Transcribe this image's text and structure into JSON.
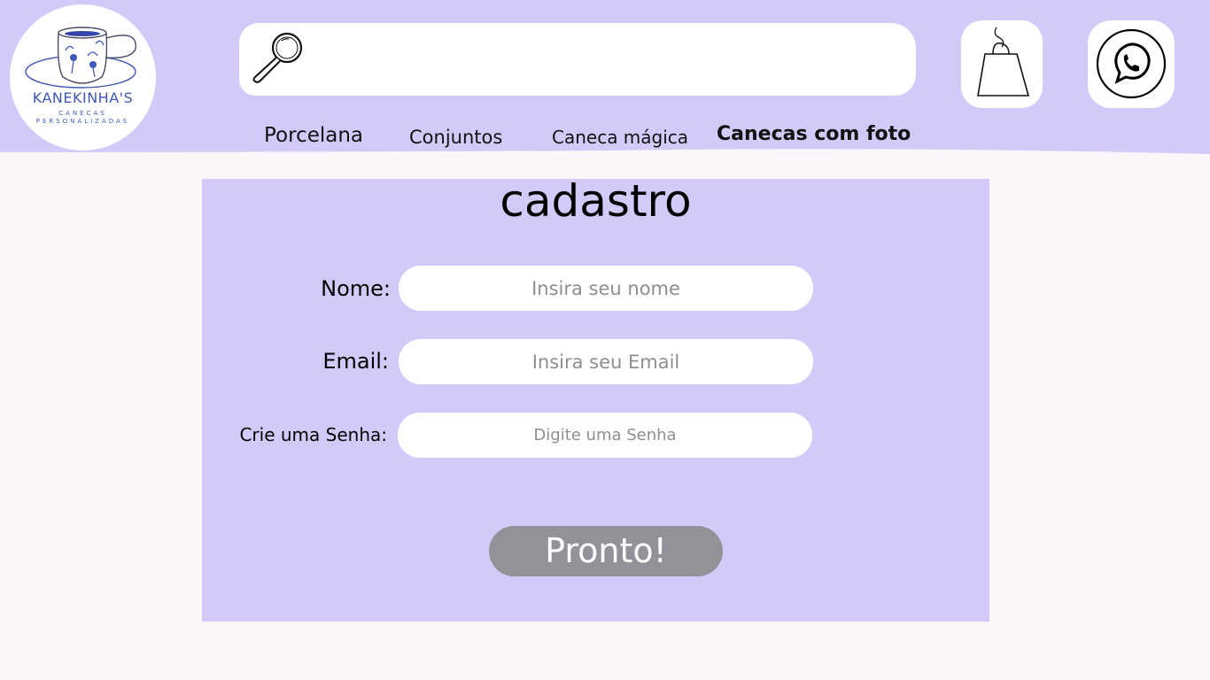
{
  "header": {
    "logo": {
      "brand": "KANEKINHA'S",
      "tagline_line1": "CANECAS",
      "tagline_line2": "PERSONALIZADAS"
    },
    "search": {
      "placeholder": "",
      "icon": "magnifier-icon"
    },
    "cart": {
      "icon": "shopping-bag-icon"
    },
    "contact": {
      "icon": "whatsapp-icon"
    },
    "nav": [
      {
        "label": "Porcelana"
      },
      {
        "label": "Conjuntos"
      },
      {
        "label": "Caneca mágica"
      },
      {
        "label": "Canecas com foto"
      }
    ]
  },
  "form": {
    "title": "cadastro",
    "fields": [
      {
        "label": "Nome:",
        "placeholder": "Insira seu nome",
        "value": ""
      },
      {
        "label": "Email:",
        "placeholder": "Insira seu Email",
        "value": ""
      },
      {
        "label": "Crie uma Senha:",
        "placeholder": "Digite uma Senha",
        "value": ""
      }
    ],
    "submit_label": "Pronto!"
  },
  "colors": {
    "header_background": "#d4caf9",
    "page_background": "#fcf5f9",
    "panel_background": "#d4caf9",
    "submit_button": "#939299",
    "logo_blue": "#4257b4"
  }
}
